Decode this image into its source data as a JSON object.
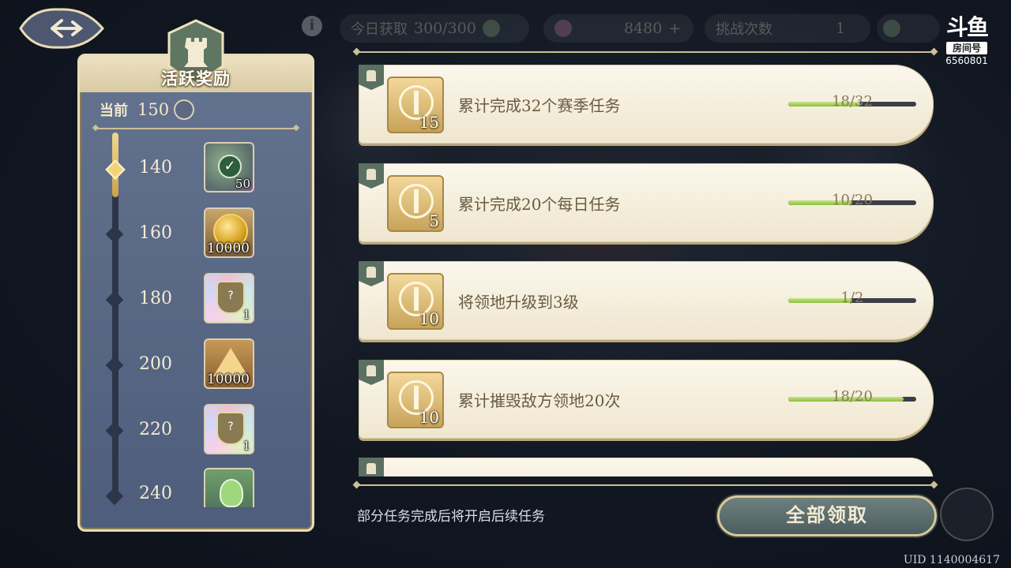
{
  "header": {
    "title": "",
    "daily_label": "今日获取",
    "daily_value": "300/300",
    "currency_value": "8480",
    "currency_plus": "+",
    "challenges_label": "挑战次数",
    "challenges_value": "1"
  },
  "watermark": {
    "brand": "斗鱼",
    "room_label": "房间号",
    "room_id": "6560801"
  },
  "activity_panel": {
    "title": "活跃奖励",
    "current_label": "当前",
    "current_value": "150",
    "tiers": [
      {
        "threshold": "140",
        "reward": "50",
        "reward_icon": "check-reward-icon",
        "claimed": true
      },
      {
        "threshold": "160",
        "reward": "10000",
        "reward_icon": "gold-coin-icon",
        "claimed": false
      },
      {
        "threshold": "180",
        "reward": "1",
        "reward_icon": "mystery-shield-icon",
        "claimed": false
      },
      {
        "threshold": "200",
        "reward": "10000",
        "reward_icon": "pyramid-icon",
        "claimed": false
      },
      {
        "threshold": "220",
        "reward": "1",
        "reward_icon": "mystery-shield-icon",
        "claimed": false
      },
      {
        "threshold": "240",
        "reward": "",
        "reward_icon": "potion-icon",
        "claimed": false
      }
    ]
  },
  "tasks": [
    {
      "points": "15",
      "name": "累计完成32个赛季任务",
      "progress": "18/32",
      "ratio": 0.5625
    },
    {
      "points": "5",
      "name": "累计完成20个每日任务",
      "progress": "10/20",
      "ratio": 0.5
    },
    {
      "points": "10",
      "name": "将领地升级到3级",
      "progress": "1/2",
      "ratio": 0.5
    },
    {
      "points": "10",
      "name": "累计摧毁敌方领地20次",
      "progress": "18/20",
      "ratio": 0.9
    }
  ],
  "footer": {
    "hint": "部分任务完成后将开启后续任务",
    "claim_all": "全部领取",
    "uid": "UID 1140004617"
  },
  "colors": {
    "accent_gold": "#cdbf97",
    "progress_green": "#8cbf3a",
    "panel_blue": "#5a6985"
  }
}
